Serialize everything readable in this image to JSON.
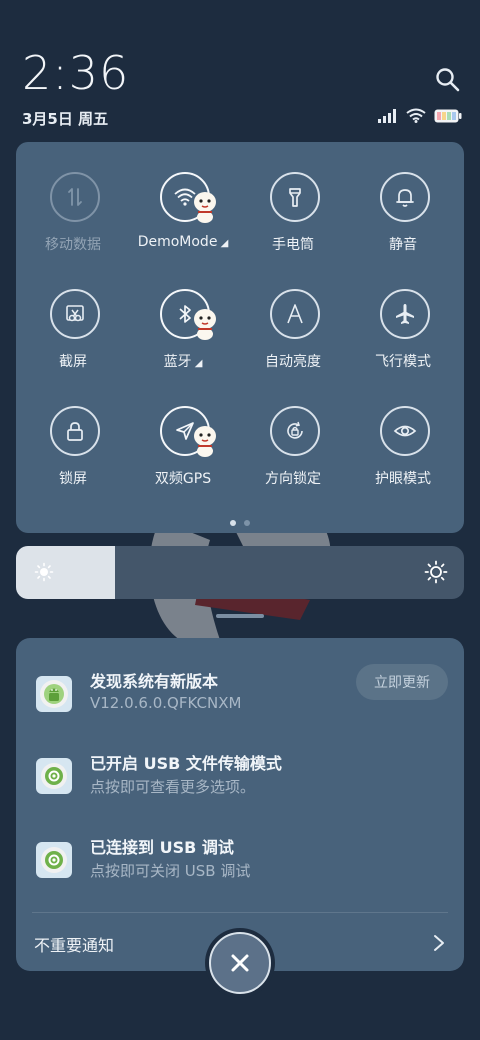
{
  "status_bar": {
    "time": "2:36",
    "date": "3月5日 周五"
  },
  "quick_settings": {
    "tiles": [
      {
        "label": "移动数据",
        "icon": "mobile-data-icon",
        "state": "disabled"
      },
      {
        "label": "DemoMode",
        "icon": "wifi-icon",
        "state": "active",
        "has_expand": true
      },
      {
        "label": "手电筒",
        "icon": "flashlight-icon",
        "state": "off"
      },
      {
        "label": "静音",
        "icon": "bell-icon",
        "state": "off"
      },
      {
        "label": "截屏",
        "icon": "screenshot-icon",
        "state": "off"
      },
      {
        "label": "蓝牙",
        "icon": "bluetooth-icon",
        "state": "active",
        "has_expand": true
      },
      {
        "label": "自动亮度",
        "icon": "auto-brightness-icon",
        "state": "off"
      },
      {
        "label": "飞行模式",
        "icon": "airplane-icon",
        "state": "off"
      },
      {
        "label": "锁屏",
        "icon": "lock-icon",
        "state": "off"
      },
      {
        "label": "双频GPS",
        "icon": "gps-icon",
        "state": "active"
      },
      {
        "label": "方向锁定",
        "icon": "rotation-lock-icon",
        "state": "off"
      },
      {
        "label": "护眼模式",
        "icon": "eye-icon",
        "state": "off"
      }
    ],
    "page_count": 2,
    "current_page": 1
  },
  "brightness": {
    "level": 0.22
  },
  "notifications": {
    "items": [
      {
        "title": "发现系统有新版本",
        "subtitle": "V12.0.6.0.QFKCNXM",
        "action": "立即更新",
        "icon": "system-update-icon"
      },
      {
        "title": "已开启 USB 文件传输模式",
        "subtitle": "点按即可查看更多选项。",
        "icon": "android-settings-icon"
      },
      {
        "title": "已连接到 USB 调试",
        "subtitle": "点按即可关闭 USB 调试",
        "icon": "android-settings-icon"
      }
    ],
    "unimportant_label": "不重要通知"
  },
  "colors": {
    "background": "#1d2c3f",
    "panel": "#48627b",
    "brightness_fill": "#dde3e9"
  }
}
